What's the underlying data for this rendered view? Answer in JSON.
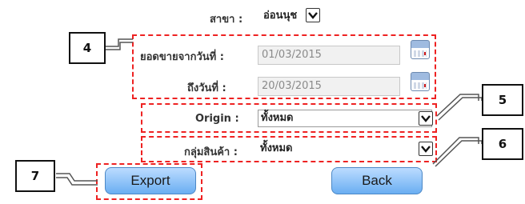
{
  "form": {
    "branch": {
      "label": "สาขา :",
      "value": "อ่อนนุช"
    },
    "date_from": {
      "label": "ยอดขายจากวันที่ :",
      "value": "01/03/2015"
    },
    "date_to": {
      "label": "ถึงวันที่ :",
      "value": "20/03/2015"
    },
    "origin": {
      "label": "Origin :",
      "value": "ทั้งหมด"
    },
    "product_group": {
      "label": "กลุ่มสินค้า :",
      "value": "ทั้งหมด"
    }
  },
  "buttons": {
    "export": "Export",
    "back": "Back"
  },
  "callouts": {
    "c4": "4",
    "c5": "5",
    "c6": "6",
    "c7": "7"
  },
  "icons": {
    "calendar": "calendar-icon",
    "dropdown": "chevron-down-icon"
  },
  "colors": {
    "annotation": "#e22222",
    "button": "#6aaef2"
  }
}
